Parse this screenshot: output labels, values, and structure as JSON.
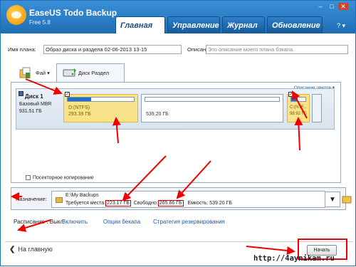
{
  "app": {
    "name": "EaseUS Todo Backup",
    "version": "Free 5.8"
  },
  "tabs": [
    "Главная",
    "Управление",
    "Журнал",
    "Обновление"
  ],
  "plan": {
    "name_label": "Имя плана:",
    "name_value": "Образ диска и раздела 02-06-2013 13-15",
    "desc_label": "Описание:",
    "desc_placeholder": "Это описание моего плана бэкапа."
  },
  "source_tabs": [
    "Фай",
    "Диск Раздел"
  ],
  "panel": {
    "colors_link": "Описание цветов"
  },
  "disk": {
    "name": "Диск 1",
    "type": "Базовый MBR",
    "size": "931.51 ГБ"
  },
  "partitions": [
    {
      "label": "D:(NTFS)",
      "size": "293.39 ГБ",
      "selected": true,
      "fill": 0.35
    },
    {
      "label": "",
      "size": "539.20 ГБ",
      "selected": false,
      "fill": 0.0
    },
    {
      "label": "C:(NTF...",
      "size": "98.92 ГБ",
      "selected": true,
      "fill": 0.45
    }
  ],
  "sector_copy": "Посекторное копирование",
  "destination": {
    "label": "Назначение:",
    "path": "E:\\My Backups",
    "required_label": "Требуется места:",
    "required_value": "223.17 ГБ",
    "free_label": "Свободно:",
    "free_value": "265.66 ГБ",
    "capacity": "Емкость: 539.20 ГБ"
  },
  "schedule": {
    "label": "Расписание : Выкл",
    "enable": "Включить",
    "options": "Опции бекапа",
    "strategy": "Стратегия резервирования"
  },
  "home": "На главную",
  "start": "Начать",
  "watermark": "http://4aynikam.ru",
  "colors": {
    "title": "#1f6fb6",
    "selected": "#f9e38a",
    "annotation": "#e00000"
  }
}
